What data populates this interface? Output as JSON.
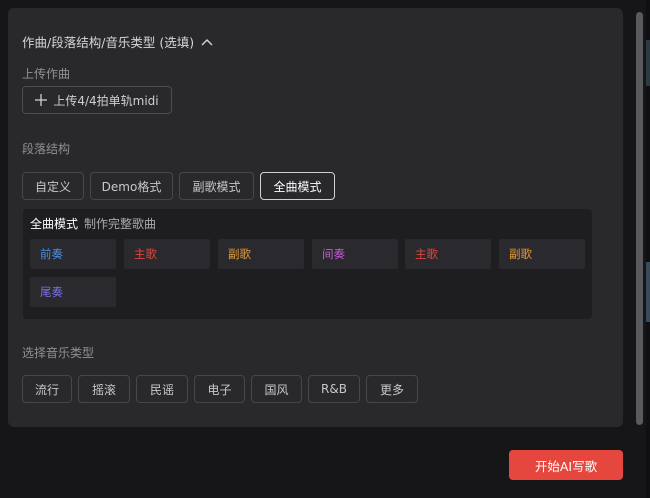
{
  "section": {
    "title": "作曲/段落结构/音乐类型 (选填)"
  },
  "upload": {
    "label": "上传作曲",
    "button": "上传4/4拍单轨midi"
  },
  "structure": {
    "label": "段落结构",
    "options": [
      "自定义",
      "Demo格式",
      "副歌模式",
      "全曲模式"
    ],
    "selected": "全曲模式"
  },
  "mode": {
    "name": "全曲模式",
    "description": "制作完整歌曲",
    "segments": [
      {
        "label": "前奏",
        "color": "#4a8fe0"
      },
      {
        "label": "主歌",
        "color": "#e0463e"
      },
      {
        "label": "副歌",
        "color": "#e59a3a"
      },
      {
        "label": "间奏",
        "color": "#c05ad0"
      },
      {
        "label": "主歌",
        "color": "#e0463e"
      },
      {
        "label": "副歌",
        "color": "#e59a3a"
      },
      {
        "label": "尾奏",
        "color": "#7a6ee6"
      }
    ]
  },
  "genre": {
    "label": "选择音乐类型",
    "options": [
      "流行",
      "摇滚",
      "民谣",
      "电子",
      "国风",
      "R&B",
      "更多"
    ]
  },
  "actions": {
    "start": "开始AI写歌"
  },
  "colors": {
    "accent": "#e5473f",
    "panel": "#29292c",
    "background": "#161618"
  }
}
